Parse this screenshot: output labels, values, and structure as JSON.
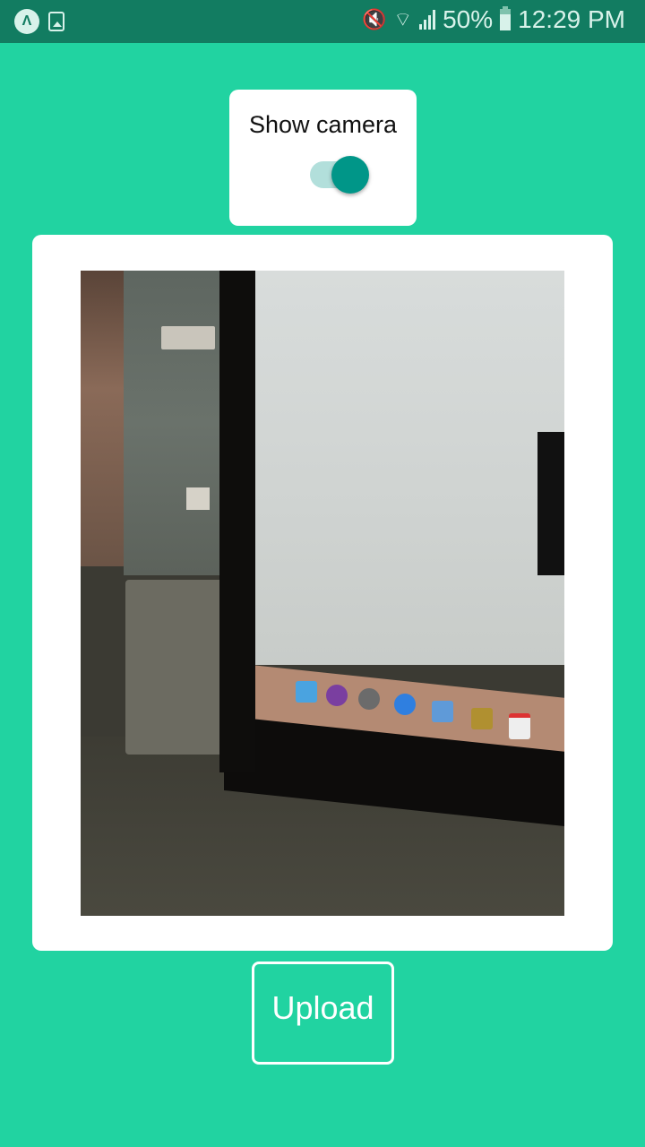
{
  "status_bar": {
    "left_icons": [
      "app-notification-icon",
      "gallery-icon"
    ],
    "right_icons": [
      "vibrate-mute-icon",
      "wifi-icon",
      "cellular-signal-icon",
      "battery-icon"
    ],
    "battery": "50%",
    "time": "12:29 PM",
    "app_glyph": "Λ"
  },
  "camera_toggle": {
    "label": "Show camera",
    "checked": true,
    "accent_color": "#009688",
    "track_color": "#b2dfdb"
  },
  "camera_preview": {
    "description": "Live camera preview showing a monitor with macOS dock on a desk"
  },
  "upload": {
    "label": "Upload"
  },
  "colors": {
    "background": "#21d3a1",
    "status_bar": "#127c61"
  }
}
